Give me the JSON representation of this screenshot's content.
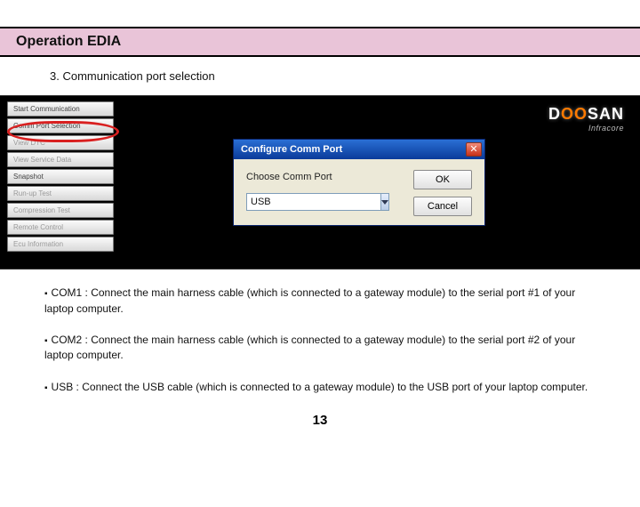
{
  "titlebar": {
    "text": "Operation EDIA"
  },
  "subhead": {
    "text": "3.   Communication port selection"
  },
  "sidemenu": {
    "items": [
      {
        "label": "Start Communication",
        "dim": false
      },
      {
        "label": "Comm Port Selection",
        "dim": false
      },
      {
        "label": "View DTC",
        "dim": true
      },
      {
        "label": "View Service Data",
        "dim": true
      },
      {
        "label": "Snapshot",
        "dim": false
      },
      {
        "label": "Run-up Test",
        "dim": true
      },
      {
        "label": "Compression Test",
        "dim": true
      },
      {
        "label": "Remote Control",
        "dim": true
      },
      {
        "label": "Ecu Information",
        "dim": true
      }
    ]
  },
  "logo": {
    "brand_pre": "D",
    "brand_accent": "OO",
    "brand_post": "SAN",
    "sub": "Infracore"
  },
  "dialog": {
    "title": "Configure Comm Port",
    "close": "✕",
    "field_label": "Choose Comm Port",
    "combo_value": "USB",
    "ok": "OK",
    "cancel": "Cancel"
  },
  "notes": {
    "bullet": "▪",
    "n1": "COM1 : Connect the main harness cable (which is connected to a gateway module) to the serial port #1 of your laptop computer.",
    "n2": "COM2 : Connect the main harness cable (which is connected to a gateway module) to the serial port #2 of your laptop computer.",
    "n3": "USB : Connect the USB cable (which is connected to a gateway module) to the USB port of your laptop computer."
  },
  "page_number": "13"
}
